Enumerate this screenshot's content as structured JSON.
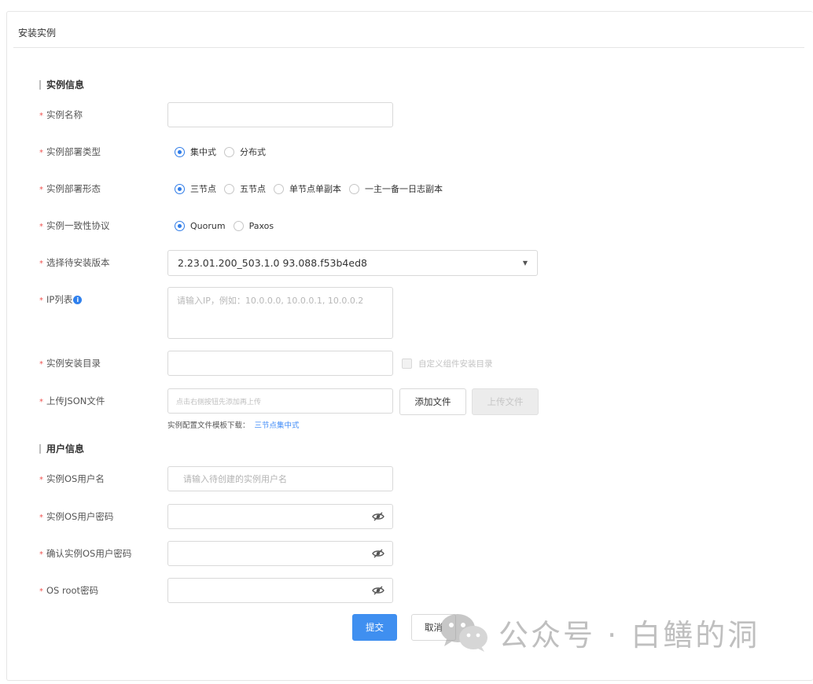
{
  "page": {
    "title": "安装实例"
  },
  "instance_section": {
    "title": "实例信息",
    "name": {
      "label": "实例名称",
      "value": ""
    },
    "deploy_type": {
      "label": "实例部署类型",
      "options": [
        "集中式",
        "分布式"
      ],
      "selected": "集中式"
    },
    "deploy_form": {
      "label": "实例部署形态",
      "options": [
        "三节点",
        "五节点",
        "单节点单副本",
        "一主一备一日志副本"
      ],
      "selected": "三节点"
    },
    "protocol": {
      "label": "实例一致性协议",
      "options": [
        "Quorum",
        "Paxos"
      ],
      "selected": "Quorum"
    },
    "version": {
      "label": "选择待安装版本",
      "value": "2.23.01.200_503.1.0 93.088.f53b4ed8"
    },
    "ip_list": {
      "label": "IP列表",
      "info_icon": "info-icon",
      "placeholder": "请输入IP，例如：10.0.0.0, 10.0.0.1, 10.0.0.2"
    },
    "install_dir": {
      "label": "实例安装目录",
      "value": "",
      "custom_dir_checkbox": {
        "label": "自定义组件安装目录",
        "checked": false
      }
    },
    "json_file": {
      "label": "上传JSON文件",
      "placeholder": "点击右侧按钮先添加再上传",
      "add_button": "添加文件",
      "upload_button": "上传文件",
      "template_hint": "实例配置文件模板下载：",
      "template_link": "三节点集中式"
    }
  },
  "user_section": {
    "title": "用户信息",
    "os_user": {
      "label": "实例OS用户名",
      "placeholder": "请输入待创建的实例用户名"
    },
    "os_password": {
      "label": "实例OS用户密码",
      "value": ""
    },
    "os_password_confirm": {
      "label": "确认实例OS用户密码",
      "value": ""
    },
    "root_password": {
      "label": "OS root密码",
      "value": ""
    }
  },
  "actions": {
    "submit": "提交",
    "cancel": "取消"
  },
  "watermark": {
    "text": "公众号 · 白鳝的洞"
  },
  "colors": {
    "primary": "#3f8ff0",
    "required": "#ef5350",
    "link": "#3d8af7"
  }
}
